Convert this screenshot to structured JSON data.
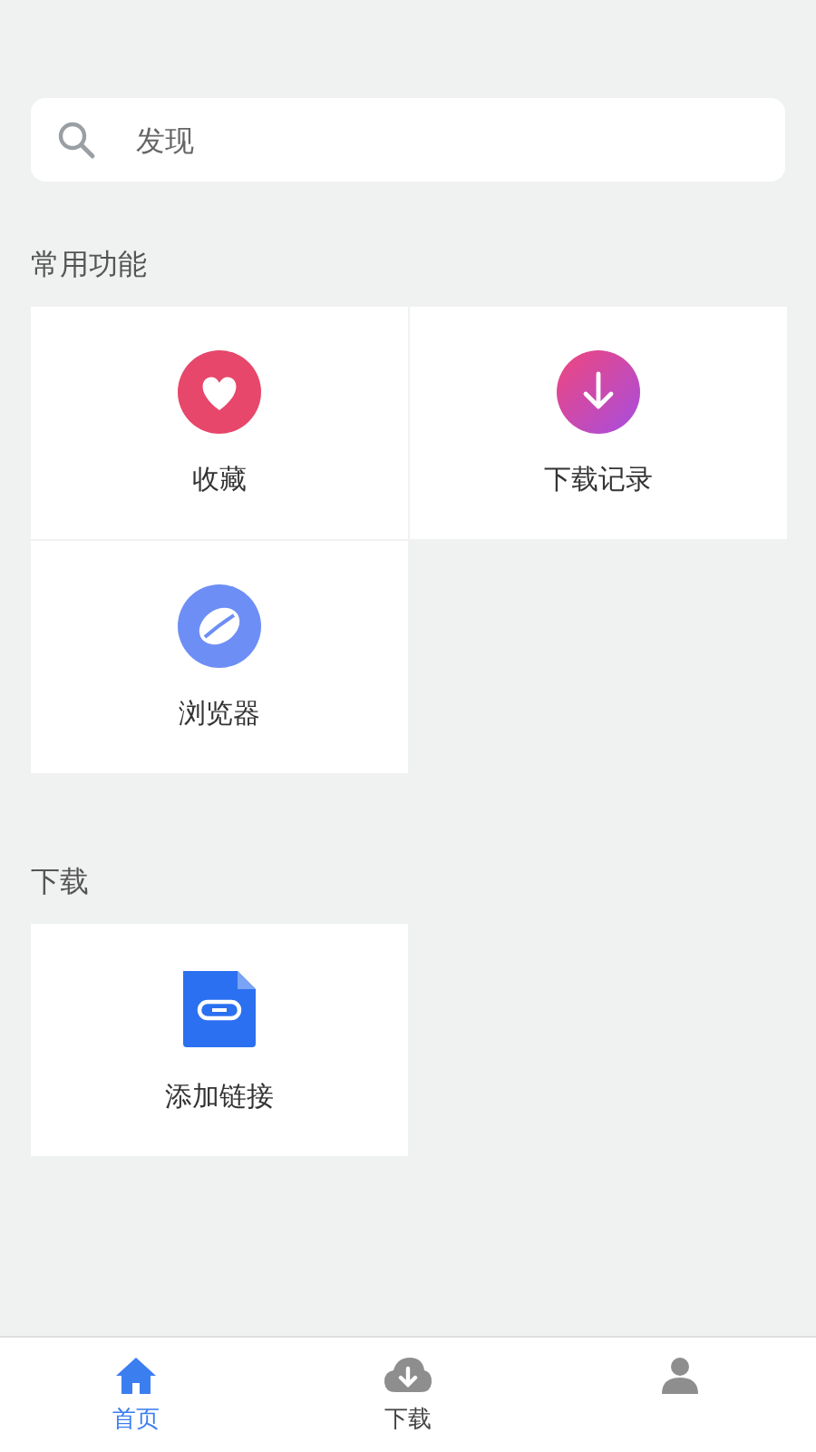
{
  "search": {
    "placeholder": "发现"
  },
  "sections": [
    {
      "title": "常用功能",
      "items": [
        {
          "label": "收藏",
          "kind": "heart"
        },
        {
          "label": "下载记录",
          "kind": "download"
        },
        {
          "label": "浏览器",
          "kind": "browser"
        }
      ]
    },
    {
      "title": "下载",
      "items": [
        {
          "label": "添加链接",
          "kind": "link"
        }
      ]
    }
  ],
  "tabs": [
    {
      "label": "首页",
      "kind": "home",
      "selected": true
    },
    {
      "label": "下载",
      "kind": "cloud",
      "selected": false
    },
    {
      "kind": "person",
      "selected": false
    }
  ]
}
